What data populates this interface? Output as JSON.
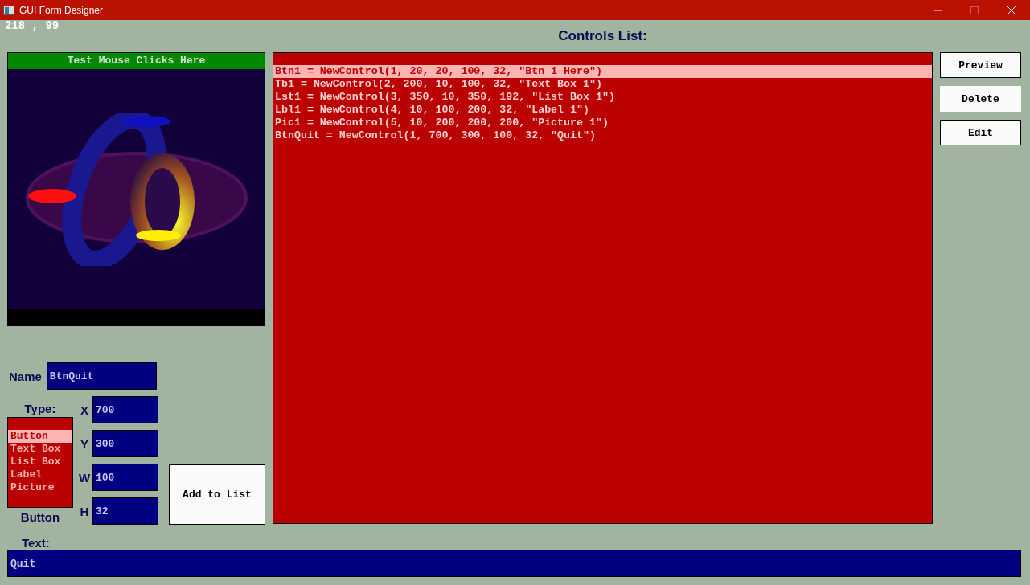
{
  "window": {
    "title": "GUI Form Designer"
  },
  "mouse_coords": "218 , 99",
  "preview": {
    "title": "Test Mouse Clicks Here"
  },
  "controls_list": {
    "heading": "Controls List:",
    "items": [
      {
        "text": "Btn1 = NewControl(1, 20, 20, 100, 32, \"Btn 1 Here\")",
        "selected": true
      },
      {
        "text": "Tb1 = NewControl(2, 200, 10, 100, 32, \"Text Box 1\")",
        "selected": false
      },
      {
        "text": "Lst1 = NewControl(3, 350, 10, 350, 192, \"List Box 1\")",
        "selected": false
      },
      {
        "text": "Lbl1 = NewControl(4, 10, 100, 200, 32, \"Label 1\")",
        "selected": false
      },
      {
        "text": "Pic1 = NewControl(5, 10, 200, 200, 200, \"Picture 1\")",
        "selected": false
      },
      {
        "text": "BtnQuit = NewControl(1, 700, 300, 100, 32, \"Quit\")",
        "selected": false
      }
    ]
  },
  "actions": [
    {
      "label": "Preview",
      "highlighted": false
    },
    {
      "label": "Delete",
      "highlighted": true
    },
    {
      "label": "Edit",
      "highlighted": false
    }
  ],
  "form": {
    "name_label": "Name",
    "name": "BtnQuit",
    "type_label": "Type:",
    "types": [
      {
        "label": "Button",
        "selected": true
      },
      {
        "label": "Text Box",
        "selected": false
      },
      {
        "label": "List Box",
        "selected": false
      },
      {
        "label": "Label",
        "selected": false
      },
      {
        "label": "Picture",
        "selected": false
      }
    ],
    "type_value": "Button",
    "coords": [
      {
        "label": "X",
        "value": "700"
      },
      {
        "label": "Y",
        "value": "300"
      },
      {
        "label": "W",
        "value": "100"
      },
      {
        "label": "H",
        "value": "32"
      }
    ],
    "add_button": "Add to List",
    "text_label": "Text:",
    "text": "Quit"
  }
}
